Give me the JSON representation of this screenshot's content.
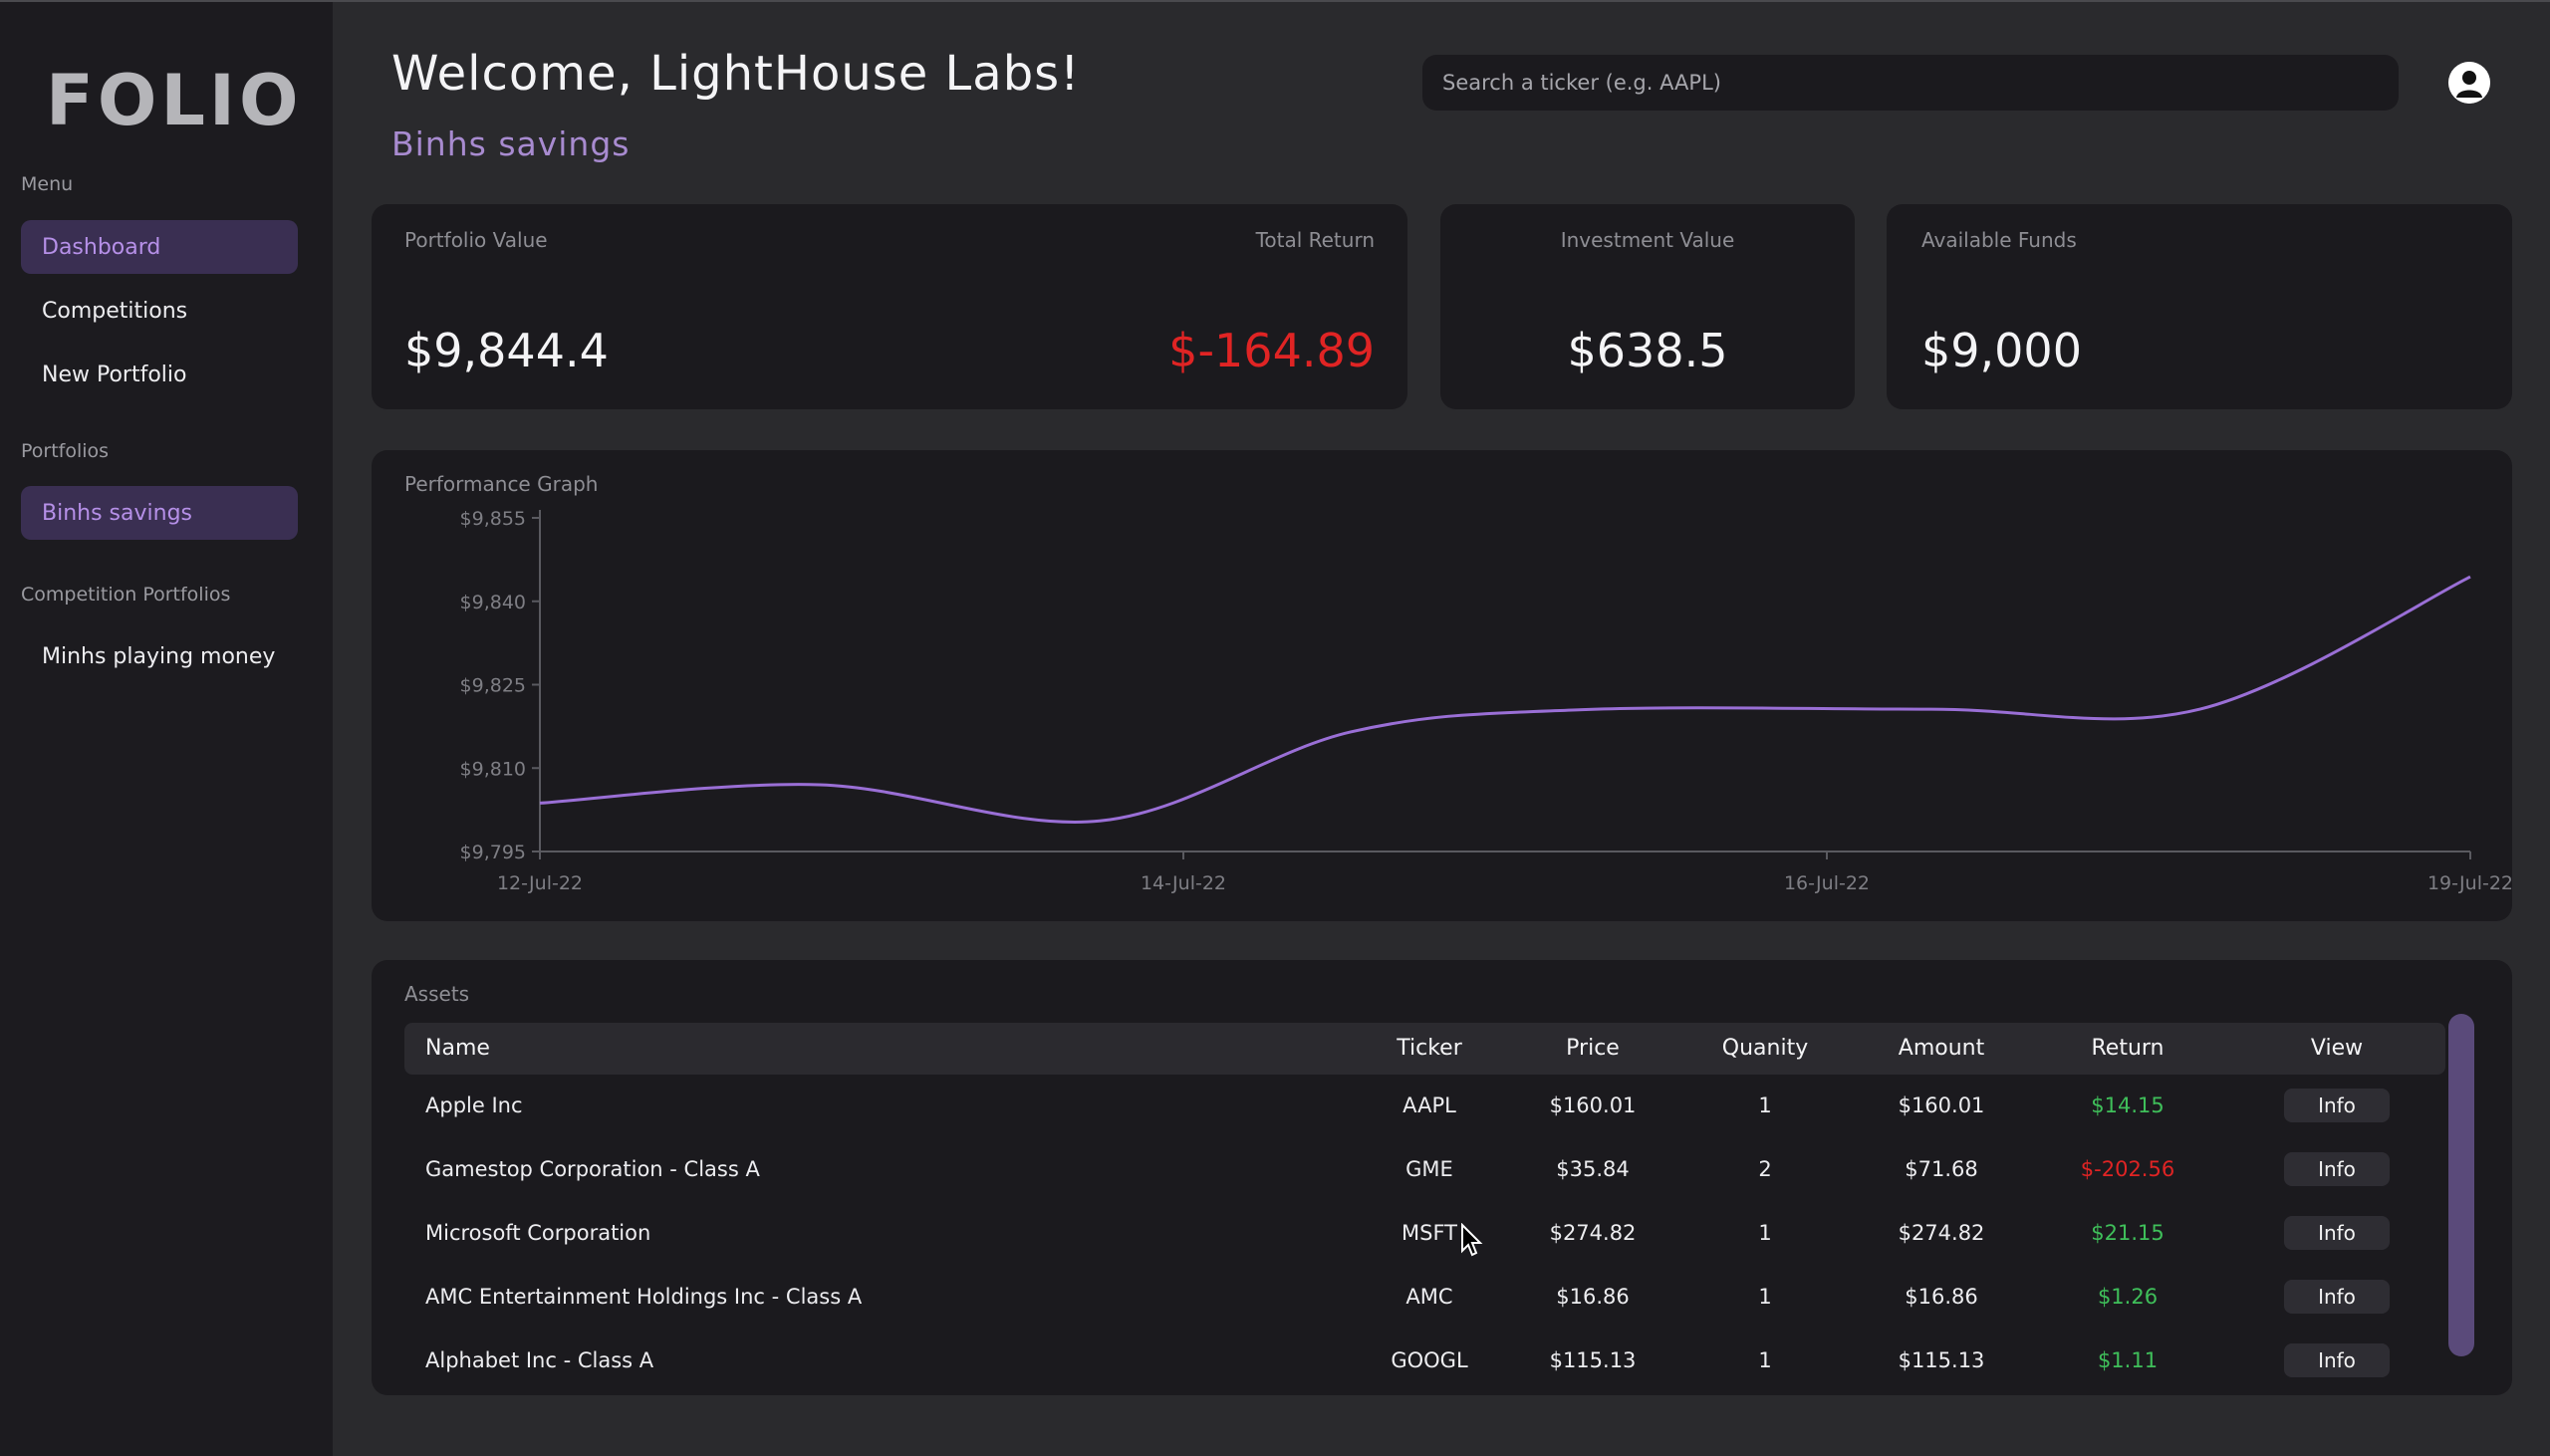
{
  "app": {
    "logo": "FOLIO"
  },
  "sidebar": {
    "menu_heading": "Menu",
    "menu_items": [
      {
        "label": "Dashboard",
        "active": true
      },
      {
        "label": "Competitions",
        "active": false
      },
      {
        "label": "New Portfolio",
        "active": false
      }
    ],
    "portfolios_heading": "Portfolios",
    "portfolios": [
      {
        "label": "Binhs savings",
        "active": true
      }
    ],
    "competition_heading": "Competition Portfolios",
    "competition_portfolios": [
      {
        "label": "Minhs playing money",
        "active": false
      }
    ]
  },
  "header": {
    "welcome": "Welcome, LightHouse Labs!",
    "portfolio_name": "Binhs savings",
    "search_placeholder": "Search a ticker (e.g. AAPL)",
    "avatar_icon": "user-icon"
  },
  "cards": {
    "portfolio_value_label": "Portfolio Value",
    "portfolio_value": "$9,844.4",
    "total_return_label": "Total Return",
    "total_return": "$-164.89",
    "investment_value_label": "Investment Value",
    "investment_value": "$638.5",
    "available_funds_label": "Available Funds",
    "available_funds": "$9,000"
  },
  "colors": {
    "accent": "#a88bd0",
    "line": "#9a6fd6",
    "positive": "#3fbf5a",
    "negative": "#e02424"
  },
  "chart_data": {
    "type": "line",
    "title": "Performance Graph",
    "xlabel": "",
    "ylabel": "",
    "x_ticks": [
      "12-Jul-22",
      "14-Jul-22",
      "16-Jul-22",
      "19-Jul-22"
    ],
    "y_ticks": [
      "$9,855",
      "$9,840",
      "$9,825",
      "$9,810",
      "$9,795"
    ],
    "ylim": [
      9795,
      9855
    ],
    "series": [
      {
        "points": [
          {
            "t": 0.0,
            "y": 9803.7
          },
          {
            "t": 0.145,
            "y": 9807.0
          },
          {
            "t": 0.29,
            "y": 9800.5
          },
          {
            "t": 0.42,
            "y": 9816.5
          },
          {
            "t": 0.54,
            "y": 9820.5
          },
          {
            "t": 0.72,
            "y": 9820.6
          },
          {
            "t": 0.86,
            "y": 9820.6
          },
          {
            "t": 1.0,
            "y": 9844.4
          }
        ]
      }
    ],
    "grid": false,
    "legend": "none"
  },
  "assets": {
    "title": "Assets",
    "columns": [
      "Name",
      "Ticker",
      "Price",
      "Quanity",
      "Amount",
      "Return",
      "View"
    ],
    "rows": [
      {
        "name": "Apple Inc",
        "ticker": "AAPL",
        "price": "$160.01",
        "quantity": "1",
        "amount": "$160.01",
        "return": "$14.15",
        "positive": true,
        "view": "Info"
      },
      {
        "name": "Gamestop Corporation - Class A",
        "ticker": "GME",
        "price": "$35.84",
        "quantity": "2",
        "amount": "$71.68",
        "return": "$-202.56",
        "positive": false,
        "view": "Info"
      },
      {
        "name": "Microsoft Corporation",
        "ticker": "MSFT",
        "price": "$274.82",
        "quantity": "1",
        "amount": "$274.82",
        "return": "$21.15",
        "positive": true,
        "view": "Info"
      },
      {
        "name": "AMC Entertainment Holdings Inc - Class A",
        "ticker": "AMC",
        "price": "$16.86",
        "quantity": "1",
        "amount": "$16.86",
        "return": "$1.26",
        "positive": true,
        "view": "Info"
      },
      {
        "name": "Alphabet Inc - Class A",
        "ticker": "GOOGL",
        "price": "$115.13",
        "quantity": "1",
        "amount": "$115.13",
        "return": "$1.11",
        "positive": true,
        "view": "Info"
      }
    ]
  }
}
